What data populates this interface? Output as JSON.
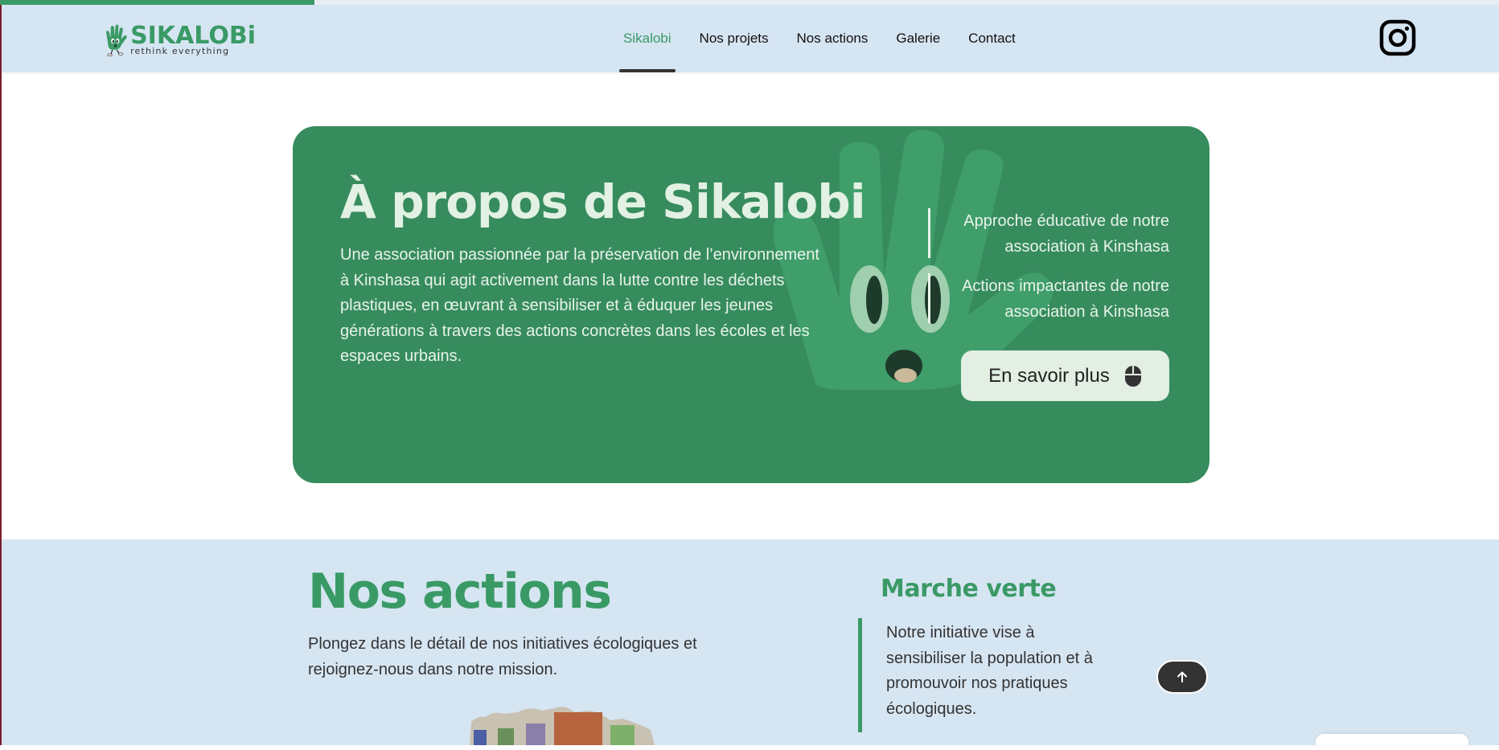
{
  "header": {
    "scroll_progress": 0.21,
    "logo": {
      "word": "SIKALOBi",
      "tagline": "rethink everything"
    },
    "nav": [
      {
        "label": "Sikalobi",
        "active": true
      },
      {
        "label": "Nos projets",
        "active": false
      },
      {
        "label": "Nos actions",
        "active": false
      },
      {
        "label": "Galerie",
        "active": false
      },
      {
        "label": "Contact",
        "active": false
      }
    ],
    "social_icon": "instagram-icon"
  },
  "about": {
    "title": "À propos de Sikalobi",
    "description": "Une association passionnée par la préservation de l’environnement à Kinshasa qui agit activement dans la lutte contre les déchets plastiques, en œuvrant à sensibiliser et à éduquer les jeunes générations à travers des actions concrètes dans les écoles et les espaces urbains.",
    "points": [
      "Approche éducative de notre association à Kinshasa",
      "Actions impactantes de notre association à Kinshasa"
    ],
    "button_label": "En savoir plus",
    "button_icon": "mouse-icon"
  },
  "actions": {
    "title": "Nos actions",
    "description": "Plongez dans le détail de nos initiatives écologiques et rejoignez-nous dans notre mission.",
    "feature_title": "Marche verte",
    "feature_text": "Notre initiative vise à sensibiliser la population et à promouvoir nos pratiques écologiques."
  },
  "colors": {
    "brand_green": "#3a9a66",
    "card_green": "#378c5e",
    "header_bg": "#d6e5f2",
    "dark_button": "#333333"
  }
}
